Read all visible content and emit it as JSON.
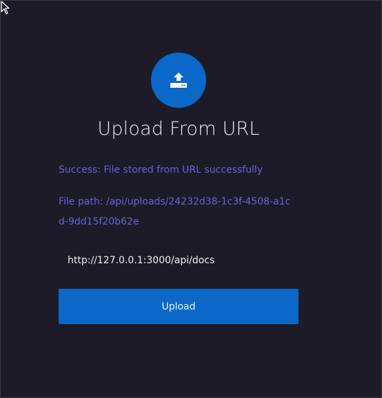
{
  "header": {
    "title": "Upload From URL",
    "icon": "upload-icon"
  },
  "messages": {
    "success": "Success: File stored from URL successfully",
    "file_path": "File path: /api/uploads/24232d38-1c3f-4508-a1cd-9dd15f20b62e"
  },
  "form": {
    "url_value": "http://127.0.0.1:3000/api/docs",
    "upload_label": "Upload"
  },
  "colors": {
    "accent": "#0b68c9",
    "message": "#6a63d8",
    "background": "#1c1b27"
  }
}
